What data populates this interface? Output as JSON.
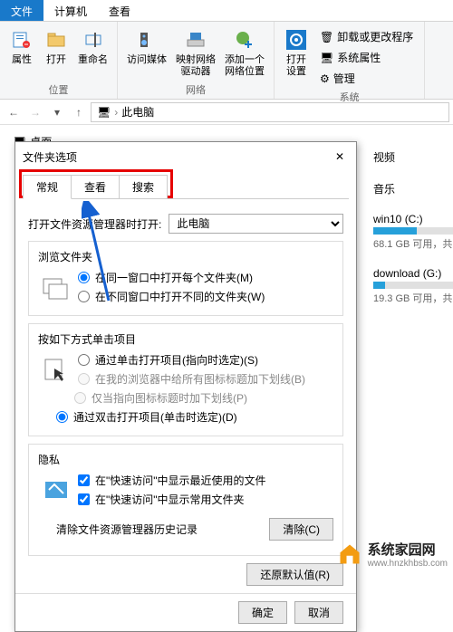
{
  "ribbon": {
    "tabs": [
      "文件",
      "计算机",
      "查看"
    ],
    "groups": {
      "location": {
        "label": "位置",
        "properties": "属性",
        "open": "打开",
        "rename": "重命名"
      },
      "network": {
        "label": "网络",
        "media": "访问媒体",
        "mapdrive": "映射网络\n驱动器",
        "addloc": "添加一个\n网络位置"
      },
      "system": {
        "label": "系统",
        "opensettings": "打开\n设置",
        "uninstall": "卸载或更改程序",
        "sysprops": "系统属性",
        "manage": "管理"
      }
    }
  },
  "nav": {
    "path": "此电脑"
  },
  "tree": {
    "desktop": "桌面"
  },
  "right": {
    "video": "视频",
    "music": "音乐",
    "drive1": {
      "name": "win10 (C:)",
      "info": "68.1 GB 可用，共",
      "fill": 55
    },
    "drive2": {
      "name": "download (G:)",
      "info": "19.3 GB 可用，共",
      "fill": 15
    }
  },
  "dialog": {
    "title": "文件夹选项",
    "tabs": {
      "general": "常规",
      "view": "查看",
      "search": "搜索"
    },
    "openLabel": "打开文件资源管理器时打开:",
    "openValue": "此电脑",
    "browse": {
      "title": "浏览文件夹",
      "r1": "在同一窗口中打开每个文件夹(M)",
      "r2": "在不同窗口中打开不同的文件夹(W)"
    },
    "click": {
      "title": "按如下方式单击项目",
      "r1": "通过单击打开项目(指向时选定)(S)",
      "r1a": "在我的浏览器中给所有图标标题加下划线(B)",
      "r1b": "仅当指向图标标题时加下划线(P)",
      "r2": "通过双击打开项目(单击时选定)(D)"
    },
    "privacy": {
      "title": "隐私",
      "c1": "在\"快速访问\"中显示最近使用的文件",
      "c2": "在\"快速访问\"中显示常用文件夹",
      "clearLabel": "清除文件资源管理器历史记录",
      "clearBtn": "清除(C)"
    },
    "restore": "还原默认值(R)",
    "ok": "确定",
    "cancel": "取消"
  },
  "watermark": {
    "title": "系统家园网",
    "url": "www.hnzkhbsb.com"
  }
}
